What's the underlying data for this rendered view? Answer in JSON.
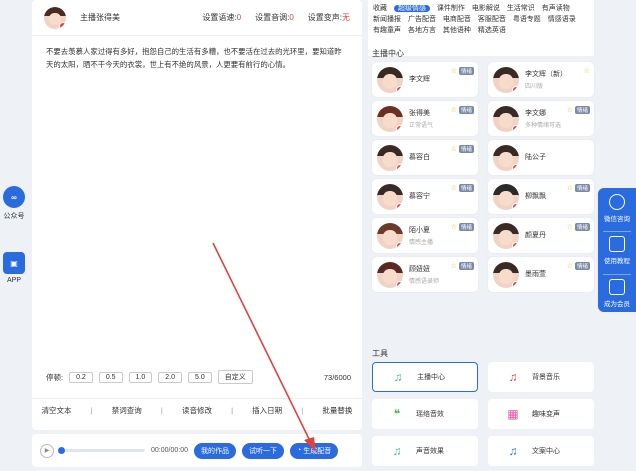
{
  "left_rail": {
    "items": [
      {
        "label": "公众号",
        "icon": "infinity-icon"
      },
      {
        "label": "APP",
        "icon": "app-icon"
      }
    ]
  },
  "editor": {
    "anchor_label": "主播张得美",
    "settings": [
      {
        "label": "设置语速:",
        "value": "0"
      },
      {
        "label": "设置音调:",
        "value": "0"
      },
      {
        "label": "设置变声:",
        "value": "无"
      }
    ],
    "text": "不要去羡慕人家过得有多好，抱怨自己的生活有多糟，也不要活在过去的光环里，要知道昨天的太阳，晒不干今天的衣裳，世上有不绝的风景，人更要有前行的心情。",
    "pause_label": "停顿:",
    "pause_options": [
      "0.2",
      "0.5",
      "1.0",
      "2.0",
      "5.0",
      "自定义"
    ],
    "char_count": "73/6000",
    "toolbar": [
      "清空文本",
      "禁词查询",
      "读音修改",
      "插入日期",
      "批量替换"
    ]
  },
  "player": {
    "time": "00:00/00:00",
    "my_works": "我的作品",
    "try_listen": "试听一下",
    "generate": "生成配音"
  },
  "categories": {
    "rows": [
      [
        "收藏",
        "超级情感",
        "课件制作",
        "电影解说",
        "生活常识",
        "有声读物"
      ],
      [
        "新闻播报",
        "广告配音",
        "电商配音",
        "客服配音",
        "粤语专题",
        "情感语录"
      ],
      [
        "有趣童声",
        "各地方言",
        "其他语种",
        "精选英语"
      ]
    ],
    "active": "超级情感"
  },
  "anchor_center": {
    "title": "主播中心",
    "voices": [
      {
        "name": "李文辉",
        "sub": "",
        "star": true,
        "emotion": "情绪"
      },
      {
        "name": "李文辉（新）",
        "sub": "四川版",
        "star": true,
        "emotion": ""
      },
      {
        "name": "张得美",
        "sub": "正常语气",
        "star": true,
        "emotion": "情绪"
      },
      {
        "name": "李文娜",
        "sub": "多种情绪可选",
        "star": true,
        "emotion": "情绪"
      },
      {
        "name": "慕容白",
        "sub": "",
        "star": true,
        "emotion": "情绪"
      },
      {
        "name": "陆公子",
        "sub": "",
        "star": false,
        "emotion": ""
      },
      {
        "name": "慕容宁",
        "sub": "",
        "star": true,
        "emotion": "情绪"
      },
      {
        "name": "柳飘飘",
        "sub": "",
        "star": true,
        "emotion": "情绪"
      },
      {
        "name": "陌小夏",
        "sub": "情感主播",
        "star": true,
        "emotion": "情绪"
      },
      {
        "name": "颜夏丹",
        "sub": "",
        "star": true,
        "emotion": "情绪"
      },
      {
        "name": "顾妞妞",
        "sub": "情感语录师",
        "star": true,
        "emotion": "情绪"
      },
      {
        "name": "墨雨萱",
        "sub": "",
        "star": true,
        "emotion": "情绪"
      }
    ]
  },
  "tools": {
    "title": "工具",
    "items": [
      {
        "label": "主播中心",
        "icon": "music-note-icon",
        "color": "#3bbfa0"
      },
      {
        "label": "背景音乐",
        "icon": "music-note-icon",
        "color": "#e0433c"
      },
      {
        "label": "瑶络音效",
        "icon": "sound-effect-icon",
        "color": "#3bbf4a"
      },
      {
        "label": "趣味变声",
        "icon": "calendar-icon",
        "color": "#e055a0"
      },
      {
        "label": "声音效果",
        "icon": "music-note-icon",
        "color": "#3bbfa0"
      },
      {
        "label": "文案中心",
        "icon": "music-note-icon",
        "color": "#2b6be0"
      }
    ]
  },
  "float_panel": {
    "items": [
      {
        "label": "微信咨询",
        "icon": "wechat-icon"
      },
      {
        "label": "使用教程",
        "icon": "chat-icon"
      },
      {
        "label": "成为会员",
        "icon": "chat-icon"
      }
    ]
  }
}
